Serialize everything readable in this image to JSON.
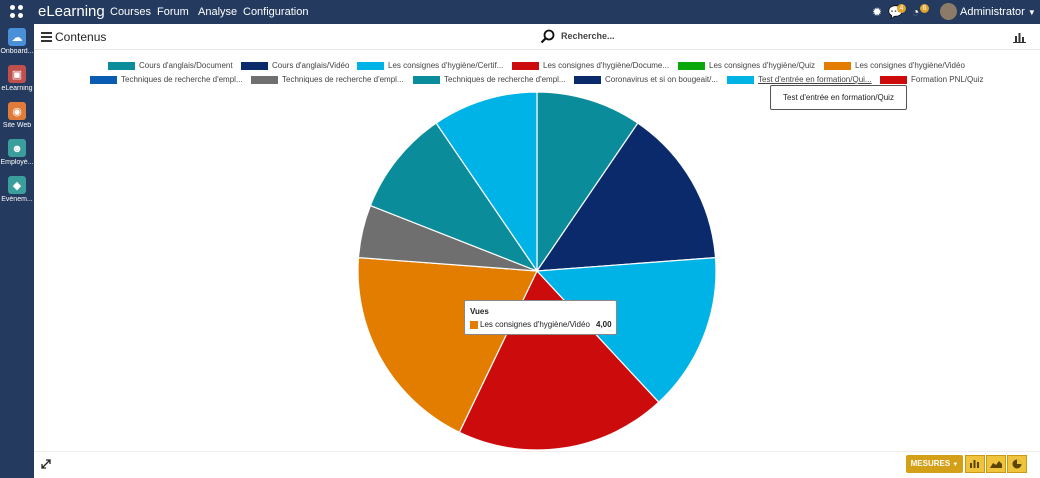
{
  "top_menu": {
    "brand": "eLearning",
    "items": [
      "Courses",
      "Forum",
      "Analyse",
      "Configuration"
    ],
    "badge_messages": "4",
    "badge_activities": "6",
    "user": "Administrator"
  },
  "left_apps": [
    {
      "label": "Onboard...",
      "color": "#4a90d9",
      "icon": "cloud-icon"
    },
    {
      "label": "eLearning",
      "color": "#c0504d",
      "icon": "elearning-icon"
    },
    {
      "label": "Site Web",
      "color": "#e07b39",
      "icon": "globe-icon"
    },
    {
      "label": "Employé...",
      "color": "#3a9e9c",
      "icon": "users-icon"
    },
    {
      "label": "Évènem...",
      "color": "#3a9e9c",
      "icon": "tag-icon"
    }
  ],
  "control": {
    "title": "Contenus",
    "search_label": "Recherche...",
    "measures_label": "MESURES"
  },
  "tooltips": {
    "legend_hover": "Test d'entrée en formation/Quiz",
    "slice_title": "Vues",
    "slice_name": "Les consignes d'hygiène/Vidéo",
    "slice_value": "4,00"
  },
  "chart_data": {
    "type": "pie",
    "measure": "Vues",
    "legend_position": "top",
    "series": [
      {
        "name": "Cours d'anglais/Document",
        "legend_label": "Cours d'anglais/Document",
        "color": "#0a8c9b",
        "value": 2
      },
      {
        "name": "Cours d'anglais/Vidéo",
        "legend_label": "Cours d'anglais/Vidéo",
        "color": "#0a2a6b",
        "value": 3
      },
      {
        "name": "Les consignes d'hygiène/Certif...",
        "legend_label": "Les consignes d'hygiène/Certif...",
        "color": "#00b3e6",
        "value": 3
      },
      {
        "name": "Les consignes d'hygiène/Docume...",
        "legend_label": "Les consignes d'hygiène/Docume...",
        "color": "#cc0c0c",
        "value": 4
      },
      {
        "name": "Les consignes d'hygiène/Quiz",
        "legend_label": "Les consignes d'hygiène/Quiz",
        "color": "#07a807",
        "value": 0
      },
      {
        "name": "Les consignes d'hygiène/Vidéo",
        "legend_label": "Les consignes d'hygiène/Vidéo",
        "color": "#e37d00",
        "value": 4
      },
      {
        "name": "Techniques de recherche d'empl... (1)",
        "legend_label": "Techniques de recherche d'empl...",
        "color": "#0a5cb3",
        "value": 0
      },
      {
        "name": "Techniques de recherche d'empl... (2)",
        "legend_label": "Techniques de recherche d'empl...",
        "color": "#6f6f6f",
        "value": 1
      },
      {
        "name": "Techniques de recherche d'empl... (3)",
        "legend_label": "Techniques de recherche d'empl...",
        "color": "#0a8c9b",
        "value": 2
      },
      {
        "name": "Coronavirus et si on bougeait/...",
        "legend_label": "Coronavirus et si on bougeait/...",
        "color": "#0a2a6b",
        "value": 0
      },
      {
        "name": "Test d'entrée en formation/Qui...",
        "legend_label": "Test d'entrée en formation/Qui...",
        "color": "#00b3e6",
        "value": 2
      },
      {
        "name": "Formation PNL/Quiz",
        "legend_label": "Formation PNL/Quiz",
        "color": "#cc0c0c",
        "value": 0
      }
    ]
  }
}
